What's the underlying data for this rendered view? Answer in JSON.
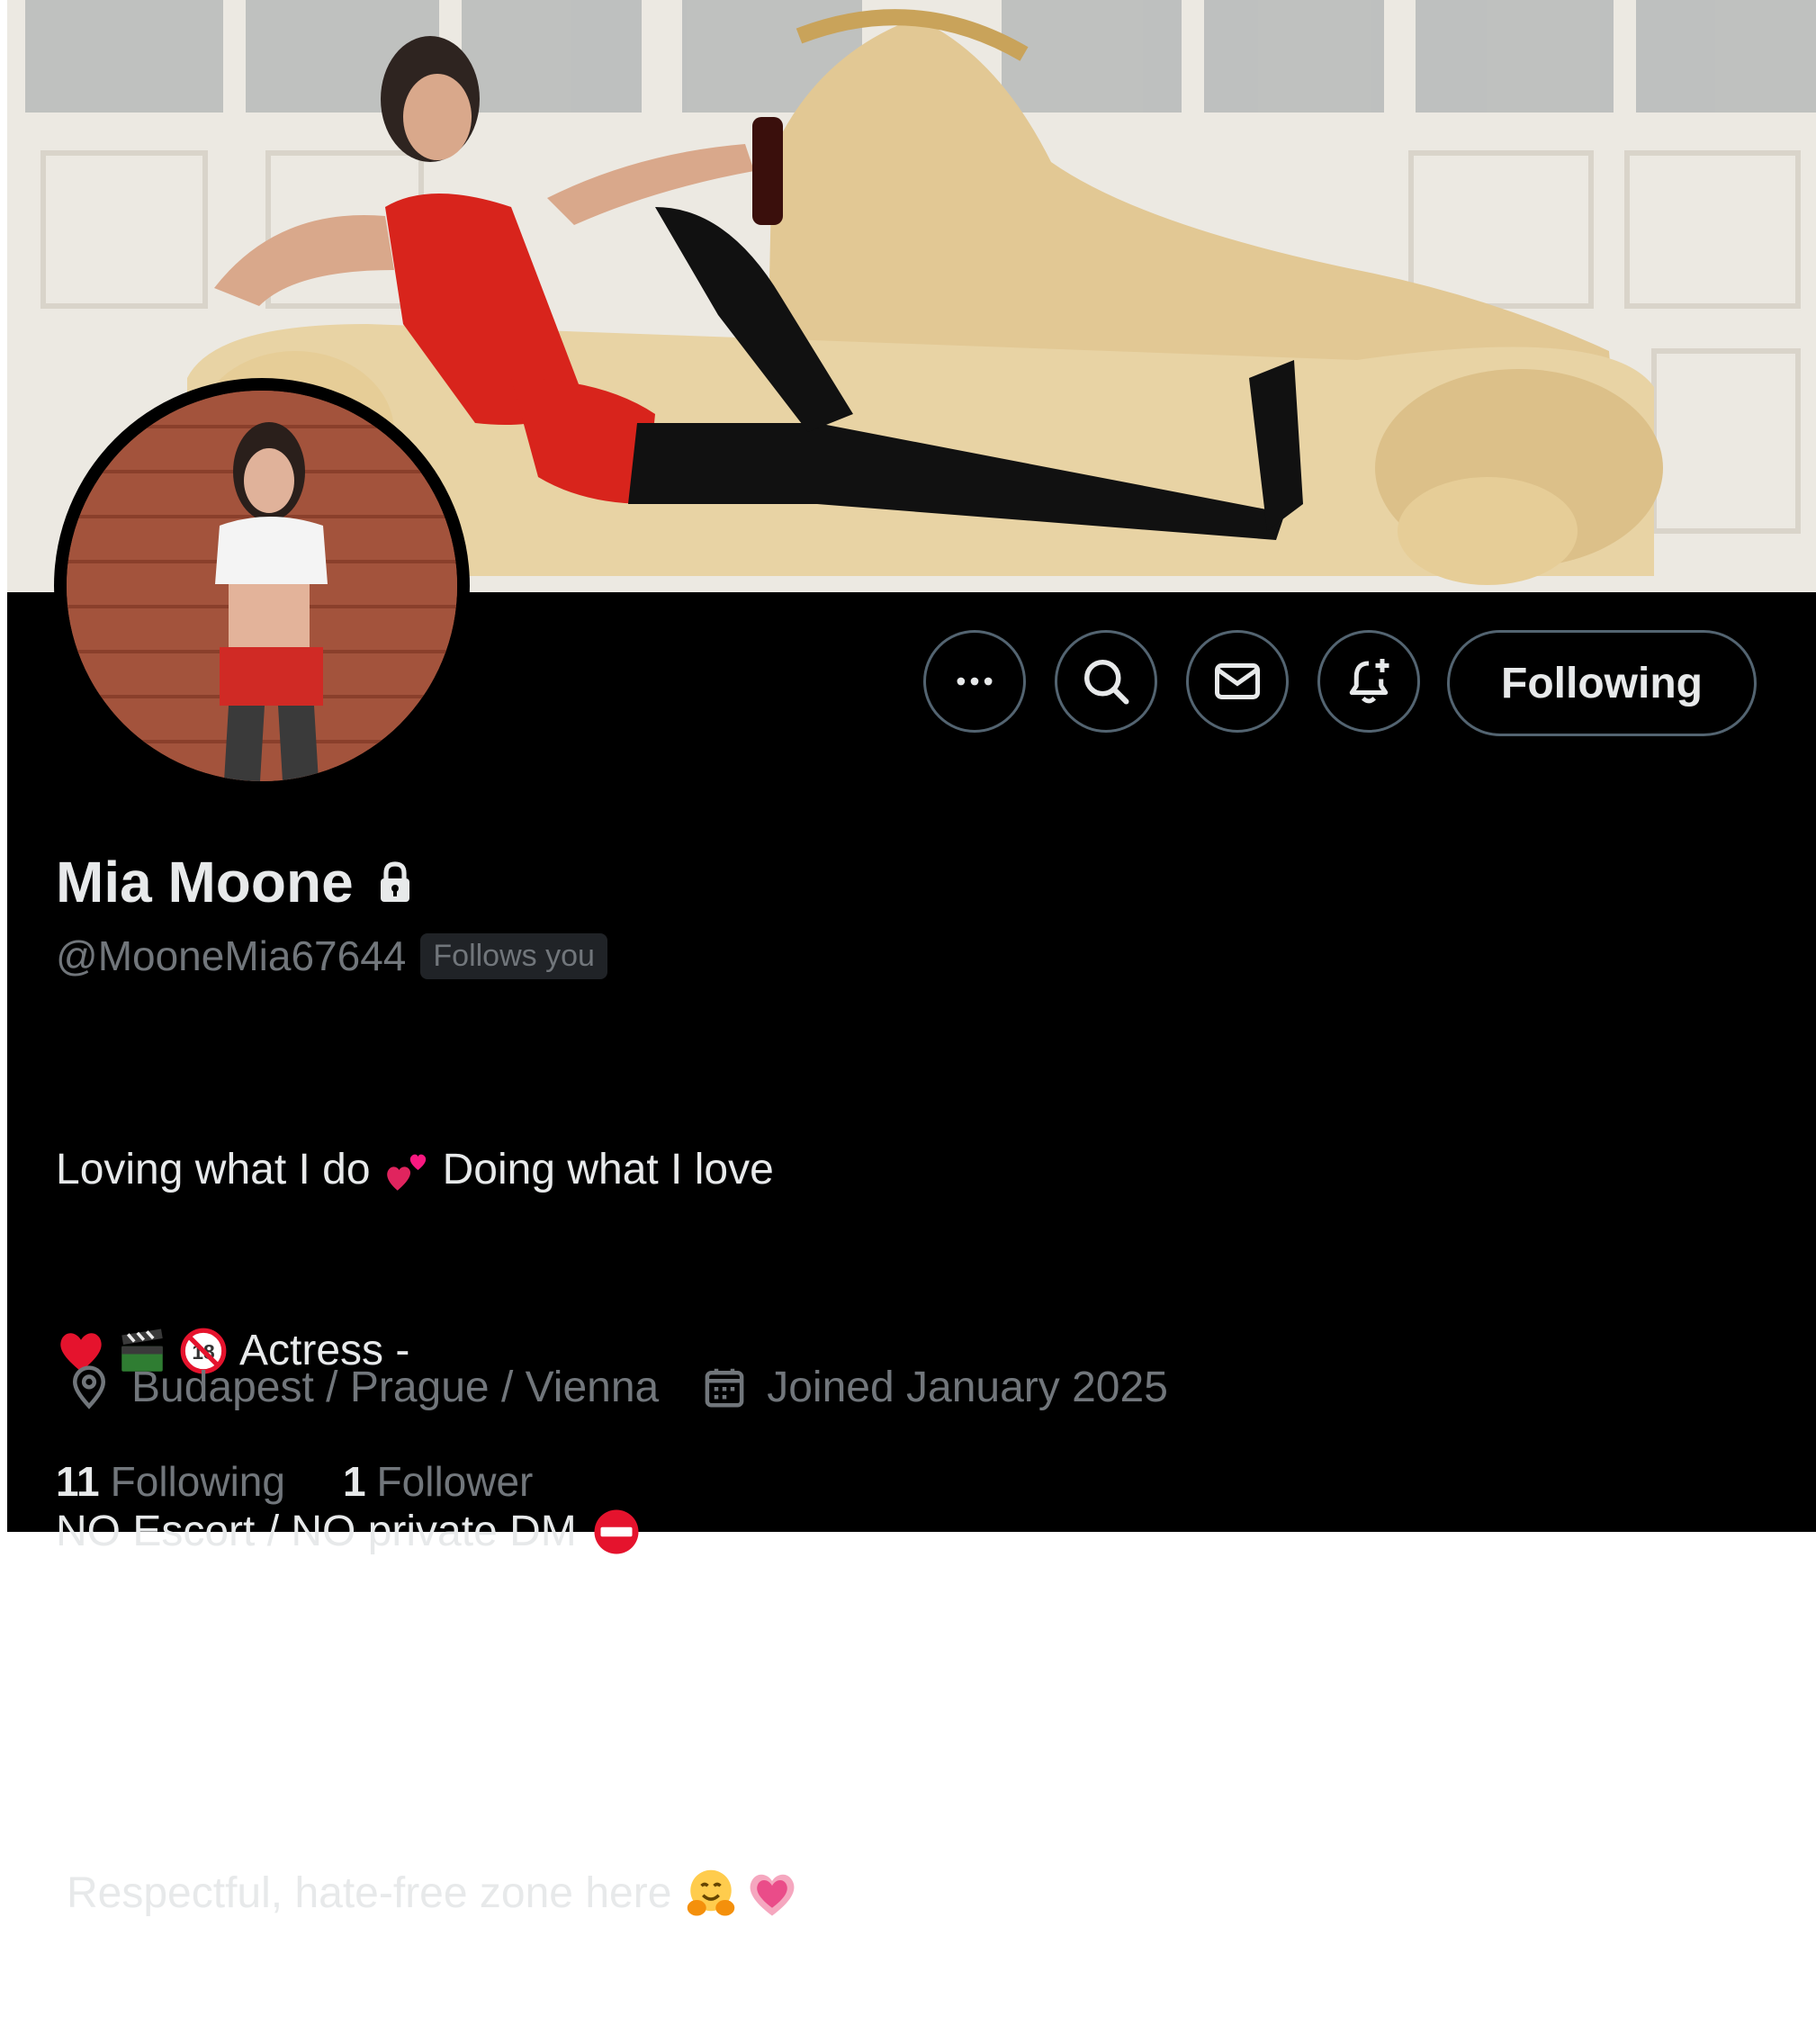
{
  "profile": {
    "display_name": "Mia Moone",
    "handle": "@MooneMia67644",
    "follows_you_badge": "Follows you",
    "protected_icon": "lock-icon"
  },
  "actions": {
    "more_icon": "more-horizontal-icon",
    "search_icon": "search-icon",
    "message_icon": "envelope-icon",
    "notify_icon": "bell-plus-icon",
    "follow_label": "Following"
  },
  "bio": {
    "line1_a": "Loving what I do",
    "line1_emoji": "two-hearts",
    "line1_b": "Doing what I love",
    "line2_emojis": [
      "red-heart",
      "clapper-board",
      "no-one-under-eighteen"
    ],
    "line2_text": "Actress -",
    "line3_text": "NO Escort / NO private DM",
    "line3_emoji": "no-entry",
    "line5_text": "Respectful, hate-free zone here",
    "line5_emojis": [
      "hugging-face",
      "growing-heart"
    ]
  },
  "meta": {
    "location_icon": "location-pin-icon",
    "location": "Budapest / Prague / Vienna",
    "calendar_icon": "calendar-icon",
    "joined": "Joined January 2025"
  },
  "stats": {
    "following_count": "11",
    "following_label": "Following",
    "followers_count": "1",
    "followers_label": "Follower"
  },
  "colors": {
    "background": "#000000",
    "primary_text": "#e7e9ea",
    "secondary_text": "#71767b",
    "button_border": "#536471",
    "badge_bg": "#202327"
  }
}
